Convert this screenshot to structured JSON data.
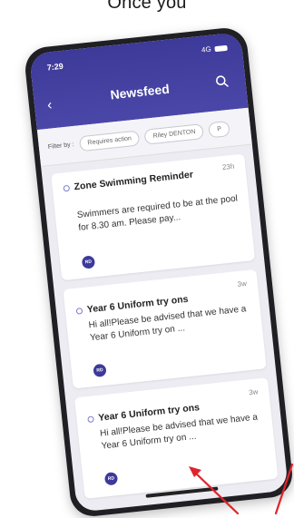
{
  "caption": "Once you",
  "status": {
    "time": "7:29",
    "signal": "4G"
  },
  "header": {
    "title": "Newsfeed"
  },
  "filters": {
    "label": "Filter by :",
    "chips": [
      "Requires action",
      "Riley DENTON",
      "P"
    ]
  },
  "feed": [
    {
      "title": "Zone Swimming Reminder",
      "body": "Swimmers are required to be at the pool for 8.30 am. Please pay...",
      "time": "23h",
      "avatar": "RD"
    },
    {
      "title": "Year 6 Uniform try ons",
      "body": "Hi all!Please be advised that we have a Year 6 Uniform try on ...",
      "time": "3w",
      "avatar": "RD"
    },
    {
      "title": "Year 6 Uniform try ons",
      "body": "Hi all!Please be advised that we have a Year 6 Uniform try on ...",
      "time": "3w",
      "avatar": "RD"
    }
  ],
  "colors": {
    "header": "#3d3a99",
    "annotation_arrow": "#e0242b"
  }
}
